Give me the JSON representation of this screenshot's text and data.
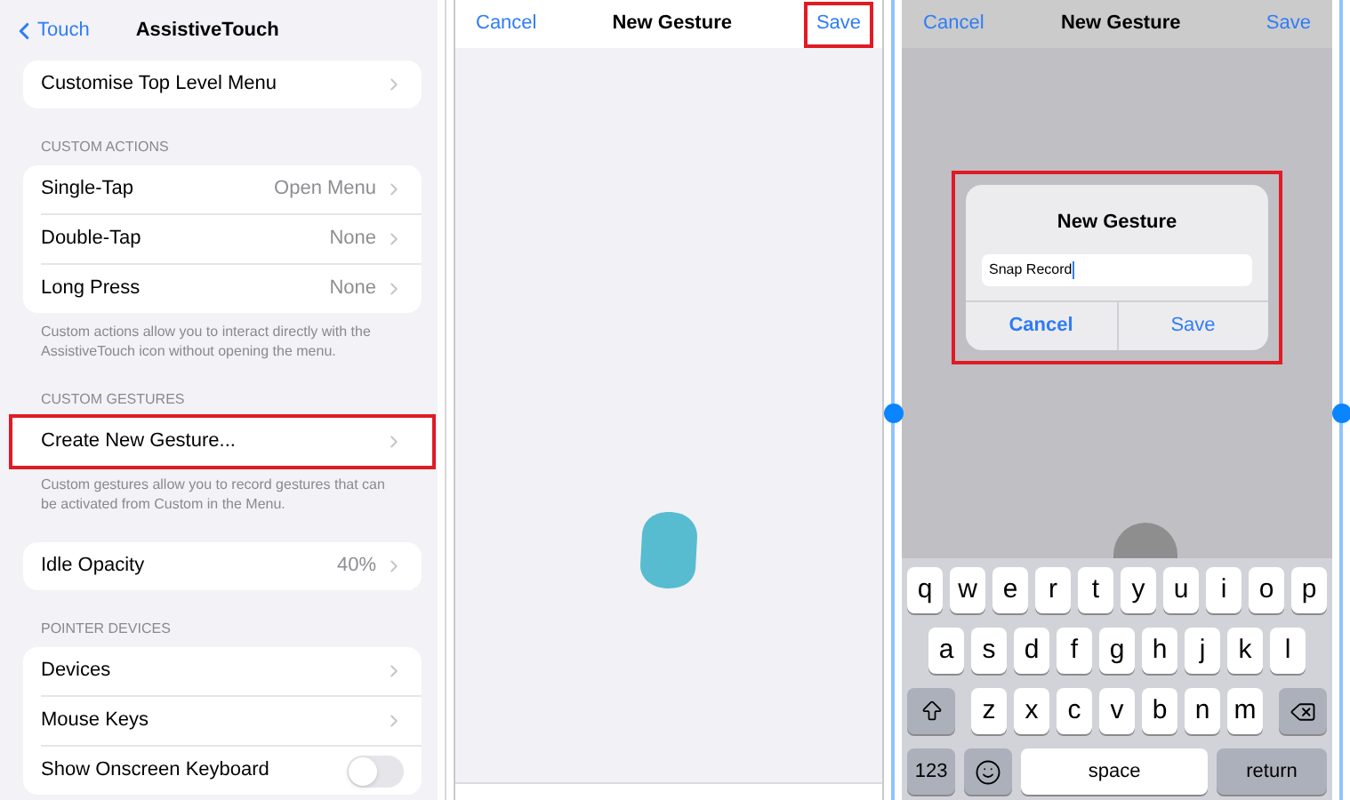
{
  "settings_screen": {
    "back": "Touch",
    "title": "AssistiveTouch",
    "groups": [
      {
        "rows": [
          {
            "kind": "link",
            "label": "Customise Top Level Menu",
            "highlighted": false
          }
        ]
      },
      {
        "header": "CUSTOM ACTIONS",
        "rows": [
          {
            "kind": "link",
            "label": "Single-Tap",
            "value": "Open Menu",
            "highlighted": false
          },
          {
            "kind": "link",
            "label": "Double-Tap",
            "value": "None",
            "highlighted": false
          },
          {
            "kind": "link",
            "label": "Long Press",
            "value": "None",
            "highlighted": false
          }
        ],
        "footer": "Custom actions allow you to interact directly with the AssistiveTouch icon without opening the menu."
      },
      {
        "header": "CUSTOM GESTURES",
        "rows": [
          {
            "kind": "link",
            "label": "Create New Gesture...",
            "highlighted": true
          }
        ],
        "footer": "Custom gestures allow you to record gestures that can be activated from Custom in the Menu."
      },
      {
        "rows": [
          {
            "kind": "link",
            "label": "Idle Opacity",
            "value": "40%",
            "highlighted": false
          }
        ]
      },
      {
        "header": "POINTER DEVICES",
        "rows": [
          {
            "kind": "link",
            "label": "Devices",
            "highlighted": false
          },
          {
            "kind": "link",
            "label": "Mouse Keys",
            "highlighted": false
          },
          {
            "kind": "toggle",
            "label": "Show Onscreen Keyboard",
            "on": false,
            "highlighted": false
          }
        ]
      }
    ]
  },
  "record_screen": {
    "cancel": "Cancel",
    "title": "New Gesture",
    "save": {
      "label": "Save",
      "highlighted": true
    }
  },
  "name_screen": {
    "cancel": "Cancel",
    "title": "New Gesture",
    "save": "Save",
    "dialog": {
      "title": "New Gesture",
      "value": "Snap Record",
      "cancel": "Cancel",
      "save": "Save",
      "highlighted": true
    },
    "keyboard": [
      [
        {
          "kind": "letter",
          "label": "q"
        },
        {
          "kind": "letter",
          "label": "w"
        },
        {
          "kind": "letter",
          "label": "e"
        },
        {
          "kind": "letter",
          "label": "r"
        },
        {
          "kind": "letter",
          "label": "t"
        },
        {
          "kind": "letter",
          "label": "y"
        },
        {
          "kind": "letter",
          "label": "u"
        },
        {
          "kind": "letter",
          "label": "i"
        },
        {
          "kind": "letter",
          "label": "o"
        },
        {
          "kind": "letter",
          "label": "p"
        }
      ],
      [
        {
          "kind": "letter",
          "label": "a"
        },
        {
          "kind": "letter",
          "label": "s"
        },
        {
          "kind": "letter",
          "label": "d"
        },
        {
          "kind": "letter",
          "label": "f"
        },
        {
          "kind": "letter",
          "label": "g"
        },
        {
          "kind": "letter",
          "label": "h"
        },
        {
          "kind": "letter",
          "label": "j"
        },
        {
          "kind": "letter",
          "label": "k"
        },
        {
          "kind": "letter",
          "label": "l"
        }
      ],
      [
        {
          "kind": "shift"
        },
        {
          "kind": "letter",
          "label": "z"
        },
        {
          "kind": "letter",
          "label": "x"
        },
        {
          "kind": "letter",
          "label": "c"
        },
        {
          "kind": "letter",
          "label": "v"
        },
        {
          "kind": "letter",
          "label": "b"
        },
        {
          "kind": "letter",
          "label": "n"
        },
        {
          "kind": "letter",
          "label": "m"
        },
        {
          "kind": "delete"
        }
      ],
      [
        {
          "kind": "numbers",
          "label": "123"
        },
        {
          "kind": "emoji"
        },
        {
          "kind": "space",
          "label": "space"
        },
        {
          "kind": "return",
          "label": "return"
        }
      ]
    ]
  }
}
